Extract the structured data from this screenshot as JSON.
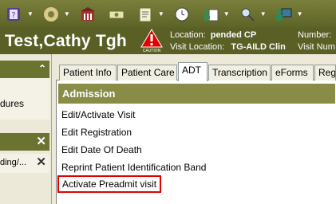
{
  "toolbar": {
    "items": [
      {
        "icon": "book-icon"
      },
      {
        "icon": "gear-icon"
      },
      {
        "icon": "building-icon"
      },
      {
        "icon": "money-icon"
      },
      {
        "icon": "clipboard-icon"
      },
      {
        "icon": "clock-icon"
      },
      {
        "icon": "person-notes-icon"
      },
      {
        "icon": "search-person-icon"
      },
      {
        "icon": "computer-user-icon"
      }
    ]
  },
  "patient": {
    "name": "Test,Cathy Tgh",
    "caution_label": "CAUTION",
    "location_label": "Location:",
    "location_value": "pended CP",
    "visit_location_label": "Visit Location:",
    "visit_location_value": "TG-AILD Clin",
    "number_label": "Number:",
    "visit_number_label": "Visit Num"
  },
  "left_pane": {
    "panel1_text": "dures",
    "panel2_text": "ding/..."
  },
  "tabs": [
    {
      "label": "Patient Info"
    },
    {
      "label": "Patient Care"
    },
    {
      "label": "ADT",
      "active": true
    },
    {
      "label": "Transcription"
    },
    {
      "label": "eForms"
    },
    {
      "label": "Reg"
    }
  ],
  "main": {
    "section_title": "Admission",
    "items": [
      {
        "label": "Edit/Activate Visit"
      },
      {
        "label": "Edit Registration"
      },
      {
        "label": "Edit Date Of Death"
      },
      {
        "label": "Reprint Patient Identification Band"
      },
      {
        "label": "Activate Preadmit visit",
        "highlighted": true
      }
    ]
  },
  "colors": {
    "toolbar": "#6a7030",
    "banner": "#595f25",
    "section_header": "#888c47",
    "highlight_border": "#e00000"
  }
}
